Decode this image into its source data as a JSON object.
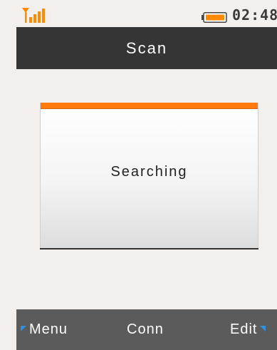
{
  "status": {
    "signal_icon": "signal-strength-icon",
    "battery_icon": "battery-icon",
    "time": "02:48",
    "accent": "#ff8a00"
  },
  "header": {
    "title": "Scan"
  },
  "dialog": {
    "message": "Searching",
    "accent": "#ff7a0a"
  },
  "softkeys": {
    "left": "Menu",
    "center": "Conn",
    "right": "Edit",
    "arrow_color": "#2f8fe0"
  }
}
